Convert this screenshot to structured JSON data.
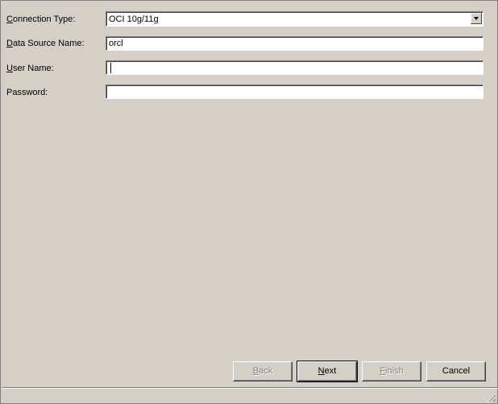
{
  "form": {
    "connection_type": {
      "label_mn": "C",
      "label_rest": "onnection Type:",
      "value": "OCI 10g/11g"
    },
    "data_source_name": {
      "label_mn": "D",
      "label_rest": "ata Source Name:",
      "value": "orcl"
    },
    "user_name": {
      "label_mn": "U",
      "label_rest": "ser Name:",
      "value": ""
    },
    "password": {
      "label": "Password:",
      "value": ""
    }
  },
  "buttons": {
    "back": {
      "mn": "B",
      "rest": "ack",
      "enabled": false
    },
    "next": {
      "mn": "N",
      "rest": "ext",
      "enabled": true
    },
    "finish": {
      "mn": "F",
      "rest": "inish",
      "enabled": false
    },
    "cancel": {
      "label": "Cancel",
      "enabled": true
    }
  },
  "icons": {
    "dropdown": "chevron-down-icon",
    "resize": "resize-grip-icon"
  }
}
